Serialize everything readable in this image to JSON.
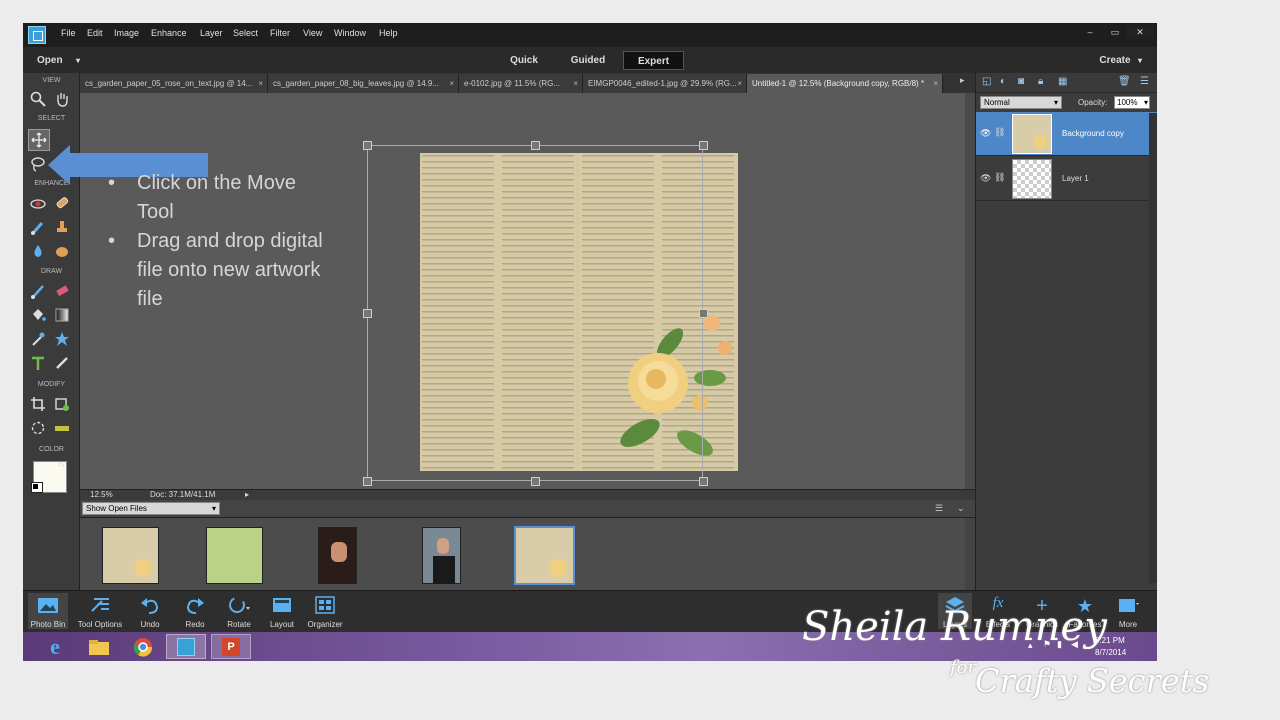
{
  "app": {
    "menu": [
      "File",
      "Edit",
      "Image",
      "Enhance",
      "Layer",
      "Select",
      "Filter",
      "View",
      "Window",
      "Help"
    ],
    "window_buttons": [
      "–",
      "▭",
      "✕"
    ]
  },
  "modebar": {
    "open": "Open",
    "modes": [
      "Quick",
      "Guided",
      "Expert"
    ],
    "active_mode": "Expert",
    "create": "Create"
  },
  "toolbox": {
    "sections": [
      "VIEW",
      "SELECT",
      "ENHANCE",
      "DRAW",
      "MODIFY",
      "COLOR"
    ]
  },
  "tabs": [
    "cs_garden_paper_05_rose_on_text.jpg @ 14...",
    "cs_garden_paper_08_big_leaves.jpg @ 14.9...",
    "e-0102.jpg @ 11.5% (RG...",
    "EIMGP0046_edited-1.jpg @ 29.9% (RG...",
    "Untitled-1 @ 12.5% (Background copy, RGB/8) *"
  ],
  "tab_close": "×",
  "instructions": [
    "Click on the Move Tool",
    "Drag and drop digital file onto new artwork file"
  ],
  "status": {
    "zoom": "12.5%",
    "doc": "Doc: 37.1M/41.1M"
  },
  "bin": {
    "show": "Show Open Files"
  },
  "layers": {
    "blend_mode": "Normal",
    "opacity_label": "Opacity:",
    "opacity_value": "100%",
    "items": [
      "Background copy",
      "Layer 1"
    ]
  },
  "bottombar": {
    "items": [
      "Photo Bin",
      "Tool Options",
      "Undo",
      "Redo",
      "Rotate",
      "Layout",
      "Organizer"
    ],
    "right_items": [
      "Layers",
      "Effects",
      "Graphics",
      "Favorites",
      "More"
    ]
  },
  "clock": {
    "time": "9:21 PM",
    "date": "8/7/2014"
  },
  "watermark": {
    "name": "Sheila Rumney",
    "for": "for",
    "brand": "Crafty Secrets"
  },
  "colors": {
    "accent_blue": "#4a90d9",
    "active_mode_bg": "#111111",
    "layer_selected": "#4d87c7"
  }
}
